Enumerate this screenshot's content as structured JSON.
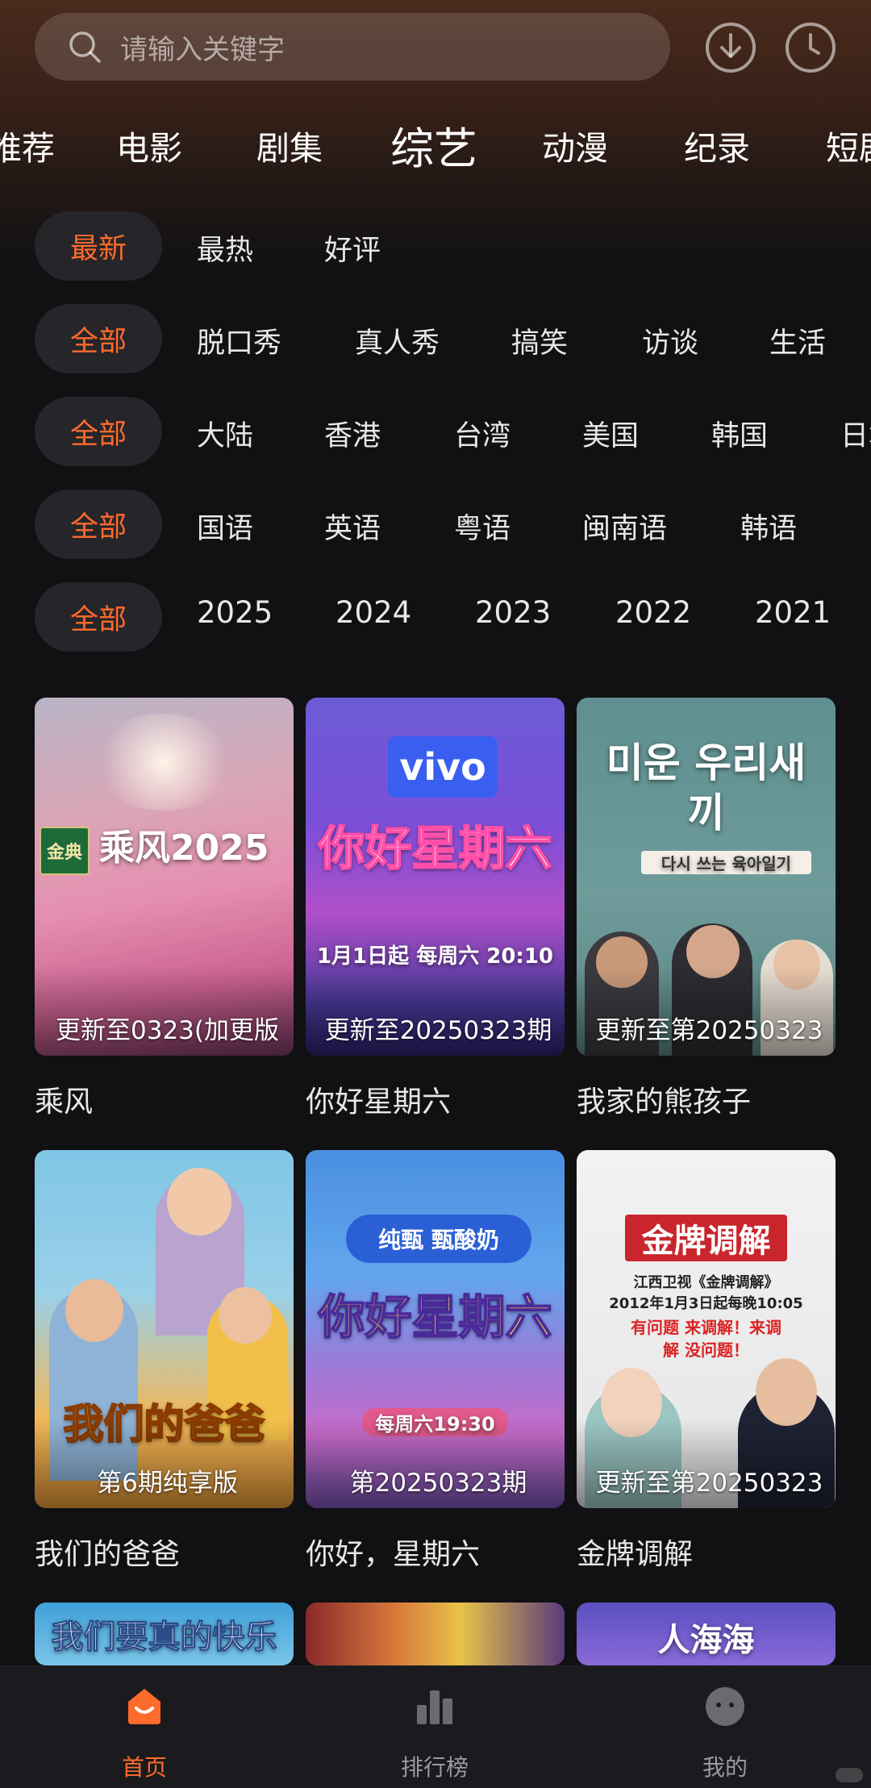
{
  "search": {
    "placeholder": "请输入关键字"
  },
  "categories": [
    "推荐",
    "电影",
    "剧集",
    "综艺",
    "动漫",
    "纪录",
    "短剧"
  ],
  "active_category": "综艺",
  "filters": {
    "sort": {
      "selected": "最新",
      "options": [
        "最热",
        "好评"
      ]
    },
    "type": {
      "selected": "全部",
      "options": [
        "脱口秀",
        "真人秀",
        "搞笑",
        "访谈",
        "生活"
      ]
    },
    "region": {
      "selected": "全部",
      "options": [
        "大陆",
        "香港",
        "台湾",
        "美国",
        "韩国",
        "日本"
      ]
    },
    "language": {
      "selected": "全部",
      "options": [
        "国语",
        "英语",
        "粤语",
        "闽南语",
        "韩语"
      ]
    },
    "year": {
      "selected": "全部",
      "options": [
        "2025",
        "2024",
        "2023",
        "2022",
        "2021"
      ]
    }
  },
  "shows": [
    {
      "title": "乘风",
      "overlay": "更新至0323(加更版",
      "poster_text": "乘风2025",
      "badge": "金典"
    },
    {
      "title": "你好星期六",
      "overlay": "更新至20250323期",
      "poster_text": "你好星期六",
      "badge": "vivo",
      "poster_sub": "1月1日起 每周六 20:10"
    },
    {
      "title": "我家的熊孩子",
      "overlay": "更新至第20250323",
      "poster_text": "미운 우리새끼",
      "poster_sub": "다시 쓰는 육아일기"
    },
    {
      "title": "我们的爸爸",
      "overlay": "第6期纯享版",
      "poster_text": "我们的爸爸"
    },
    {
      "title": "你好，星期六",
      "overlay": "第20250323期",
      "poster_text": "你好星期六",
      "badge": "纯甄 甄酸奶",
      "poster_sub": "每周六19:30"
    },
    {
      "title": "金牌调解",
      "overlay": "更新至第20250323",
      "poster_text": "金牌调解",
      "poster_sub": "江西卫视《金牌调解》",
      "poster_sub2": "2012年1月3日起每晚10:05",
      "poster_sub3": "有问题 来调解！来调解 没问题！"
    },
    {
      "title": "",
      "overlay": "",
      "poster_text": "我们要真的快乐"
    },
    {
      "title": "",
      "overlay": "",
      "poster_text": ""
    },
    {
      "title": "",
      "overlay": "",
      "poster_text": "人海海"
    }
  ],
  "tabs": [
    {
      "label": "首页",
      "icon": "home-icon"
    },
    {
      "label": "排行榜",
      "icon": "ranking-icon"
    },
    {
      "label": "我的",
      "icon": "profile-icon"
    }
  ],
  "colors": {
    "accent": "#ff6b2c",
    "background": "#111114",
    "chip": "#25252a"
  }
}
